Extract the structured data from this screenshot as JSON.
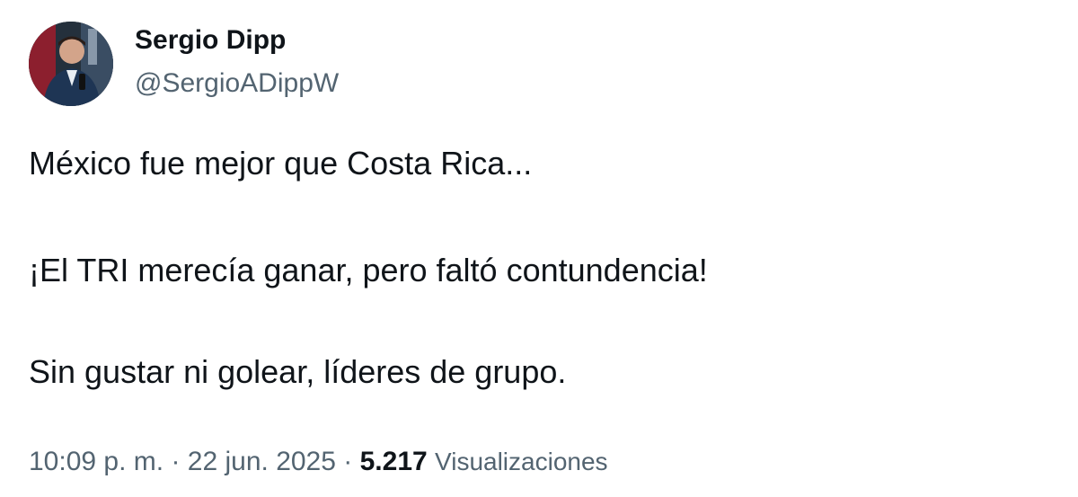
{
  "author": {
    "display_name": "Sergio Dipp",
    "handle": "@SergioADippW"
  },
  "tweet": {
    "lines": [
      "México fue mejor que Costa Rica...",
      "¡El TRI merecía ganar, pero faltó contundencia!",
      "Sin gustar ni golear, líderes de grupo."
    ]
  },
  "meta": {
    "time": "10:09 p. m.",
    "separator": "·",
    "date": "22 jun. 2025",
    "views_count": "5.217",
    "views_label": "Visualizaciones"
  }
}
